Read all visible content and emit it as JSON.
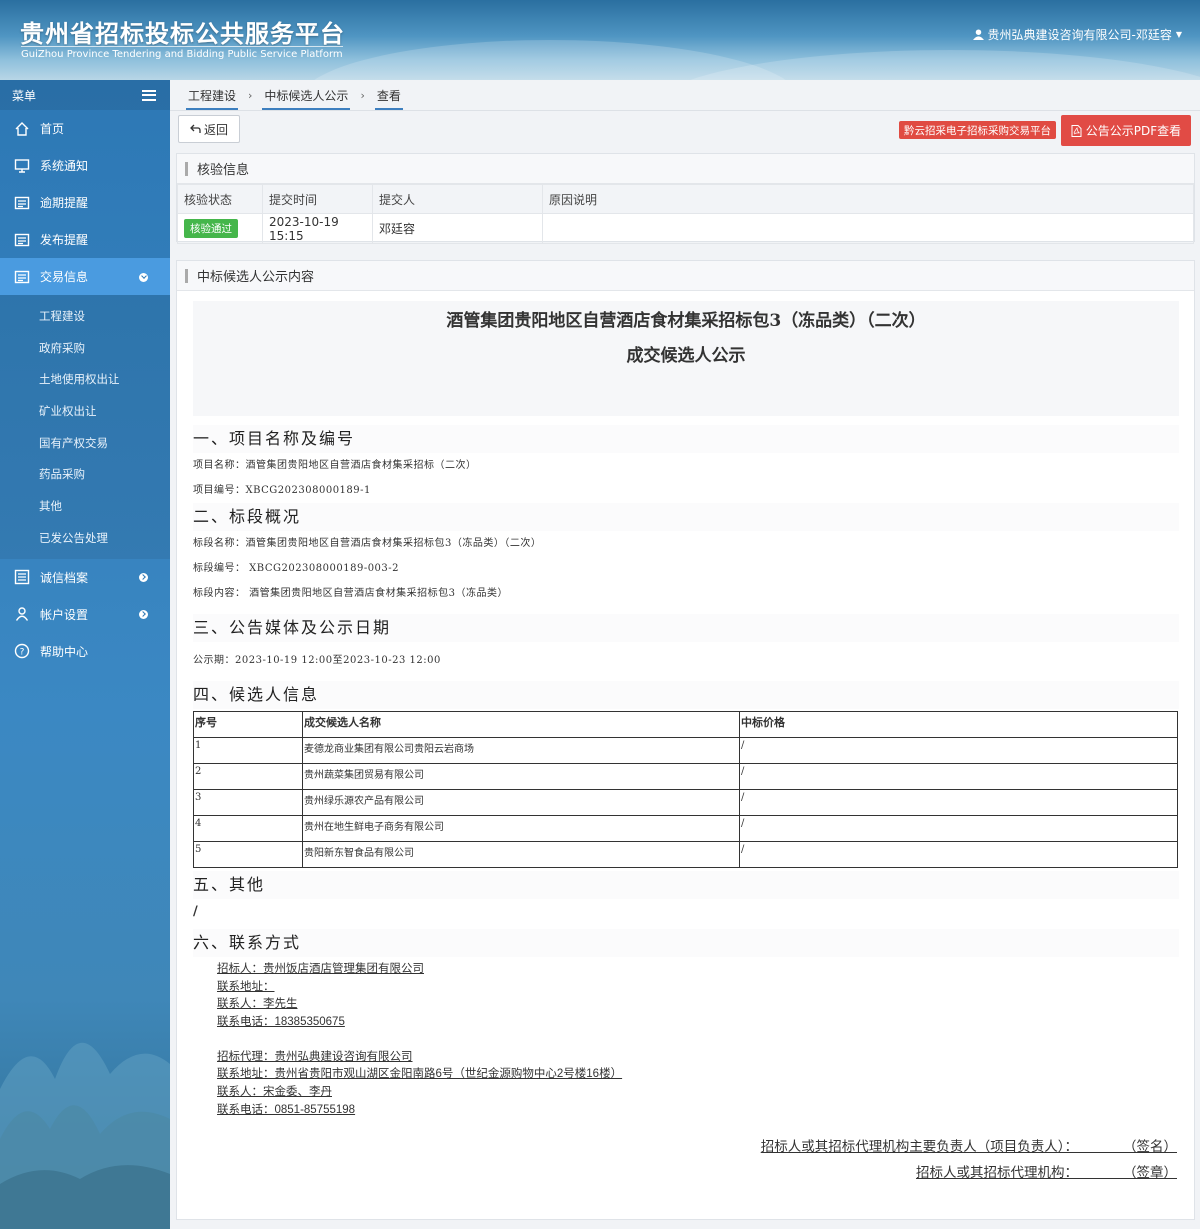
{
  "header": {
    "title": "贵州省招标投标公共服务平台",
    "subtitle": "GuiZhou Province Tendering and Bidding Public Service Platform",
    "user": "贵州弘典建设咨询有限公司-邓廷容"
  },
  "sidebar": {
    "menu_label": "菜单",
    "items": [
      {
        "label": "首页",
        "icon": "home-icon"
      },
      {
        "label": "系统通知",
        "icon": "monitor-icon"
      },
      {
        "label": "逾期提醒",
        "icon": "list-icon"
      },
      {
        "label": "发布提醒",
        "icon": "list-icon"
      },
      {
        "label": "交易信息",
        "icon": "list-icon"
      }
    ],
    "sub_items": [
      "工程建设",
      "政府采购",
      "土地使用权出让",
      "矿业权出让",
      "国有产权交易",
      "药品采购",
      "其他",
      "已发公告处理"
    ],
    "bottom_items": [
      {
        "label": "诚信档案",
        "icon": "archive-icon"
      },
      {
        "label": "帐户设置",
        "icon": "user-icon"
      },
      {
        "label": "帮助中心",
        "icon": "help-icon"
      }
    ]
  },
  "breadcrumb": [
    "工程建设",
    "中标候选人公示",
    "查看"
  ],
  "toolbar": {
    "back_label": "返回",
    "platform_badge": "黔云招采电子招标采购交易平台",
    "pdf_label": "公告公示PDF查看"
  },
  "verify": {
    "title": "核验信息",
    "columns": [
      "核验状态",
      "提交时间",
      "提交人",
      "原因说明"
    ],
    "row": {
      "status": "核验通过",
      "time": "2023-10-19 15:15",
      "submitter": "邓廷容",
      "reason": ""
    }
  },
  "content": {
    "title": "中标候选人公示内容",
    "doc_title": "酒管集团贵阳地区自营酒店食材集采招标包3（冻品类）（二次）",
    "doc_subtitle": "成交候选人公示",
    "s1_title": "一、项目名称及编号",
    "s1_lines": [
      "项目名称：酒管集团贵阳地区自营酒店食材集采招标（二次）",
      "项目编号：XBCG202308000189-1"
    ],
    "s2_title": "二、标段概况",
    "s2_lines": [
      "标段名称：酒管集团贵阳地区自营酒店食材集采招标包3（冻品类）（二次）",
      "标段编号： XBCG202308000189-003-2",
      "标段内容： 酒管集团贵阳地区自营酒店食材集采招标包3（冻品类）"
    ],
    "s3_title": "三、公告媒体及公示日期",
    "s3_lines": [
      "公示期：2023-10-19 12:00至2023-10-23 12:00"
    ],
    "s4_title": "四、候选人信息",
    "cand_columns": [
      "序号",
      "成交候选人名称",
      "中标价格"
    ],
    "candidates": [
      {
        "no": "1",
        "name": "麦德龙商业集团有限公司贵阳云岩商场",
        "price": "/"
      },
      {
        "no": "2",
        "name": "贵州蔬菜集团贸易有限公司",
        "price": "/"
      },
      {
        "no": "3",
        "name": "贵州绿乐源农产品有限公司",
        "price": "/"
      },
      {
        "no": "4",
        "name": "贵州在地生鲜电子商务有限公司",
        "price": "/"
      },
      {
        "no": "5",
        "name": "贵阳新东智食品有限公司",
        "price": "/"
      }
    ],
    "s5_title": "五、其他",
    "s5_text": "/",
    "s6_title": "六、联系方式",
    "contact1": [
      "招标人：贵州饭店酒店管理集团有限公司",
      "联系地址：",
      "联系人：李先生",
      "联系电话：18385350675"
    ],
    "contact2": [
      "招标代理：贵州弘典建设咨询有限公司",
      "联系地址：贵州省贵阳市观山湖区金阳南路6号（世纪金源购物中心2号楼16楼）",
      "联系人：宋金委、李丹",
      "联系电话：0851-85755198"
    ],
    "sign1": "招标人或其招标代理机构主要负责人（项目负责人）：            （签名）",
    "sign2": "招标人或其招标代理机构：            （签章）"
  }
}
